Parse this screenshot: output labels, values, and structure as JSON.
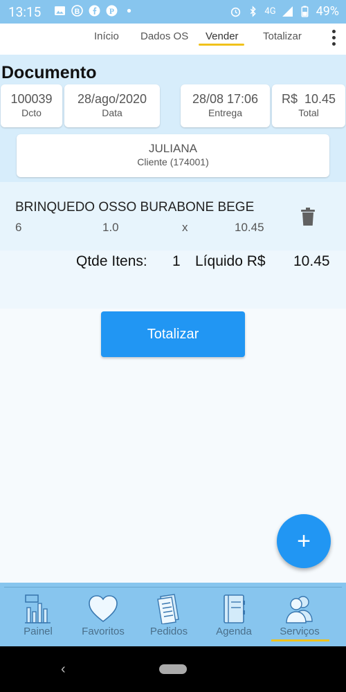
{
  "status": {
    "time": "13:15",
    "network": "4G",
    "battery": "49%"
  },
  "tabs": [
    {
      "label": "Início"
    },
    {
      "label": "Dados OS"
    },
    {
      "label": "Vender"
    },
    {
      "label": "Totalizar"
    }
  ],
  "document": {
    "title": "Documento",
    "dcto": {
      "value": "100039",
      "label": "Dcto"
    },
    "data": {
      "value": "28/ago/2020",
      "label": "Data"
    },
    "entrega": {
      "value": "28/08 17:06",
      "label": "Entrega"
    },
    "total": {
      "value": "R$  10.45",
      "label": "Total"
    },
    "client": {
      "name": "JULIANA",
      "label": "Cliente (174001)"
    }
  },
  "items": [
    {
      "name": "BRINQUEDO OSSO BURABONE BEGE",
      "qty": "6",
      "unit": "1.0",
      "x": "x",
      "price": "10.45"
    }
  ],
  "summary": {
    "qty_label": "Qtde Itens:",
    "qty_value": "1",
    "liquid_label": "Líquido R$",
    "liquid_value": "10.45"
  },
  "totalizar_button": "Totalizar",
  "fab": "+",
  "bottom_nav": [
    {
      "label": "Painel",
      "icon": "bar-chart-icon"
    },
    {
      "label": "Favoritos",
      "icon": "heart-icon"
    },
    {
      "label": "Pedidos",
      "icon": "document-icon"
    },
    {
      "label": "Agenda",
      "icon": "notebook-icon"
    },
    {
      "label": "Serviços",
      "icon": "people-icon"
    }
  ],
  "colors": {
    "accent": "#2196f3",
    "bar": "#87c5ee",
    "highlight": "#f0c21b"
  }
}
